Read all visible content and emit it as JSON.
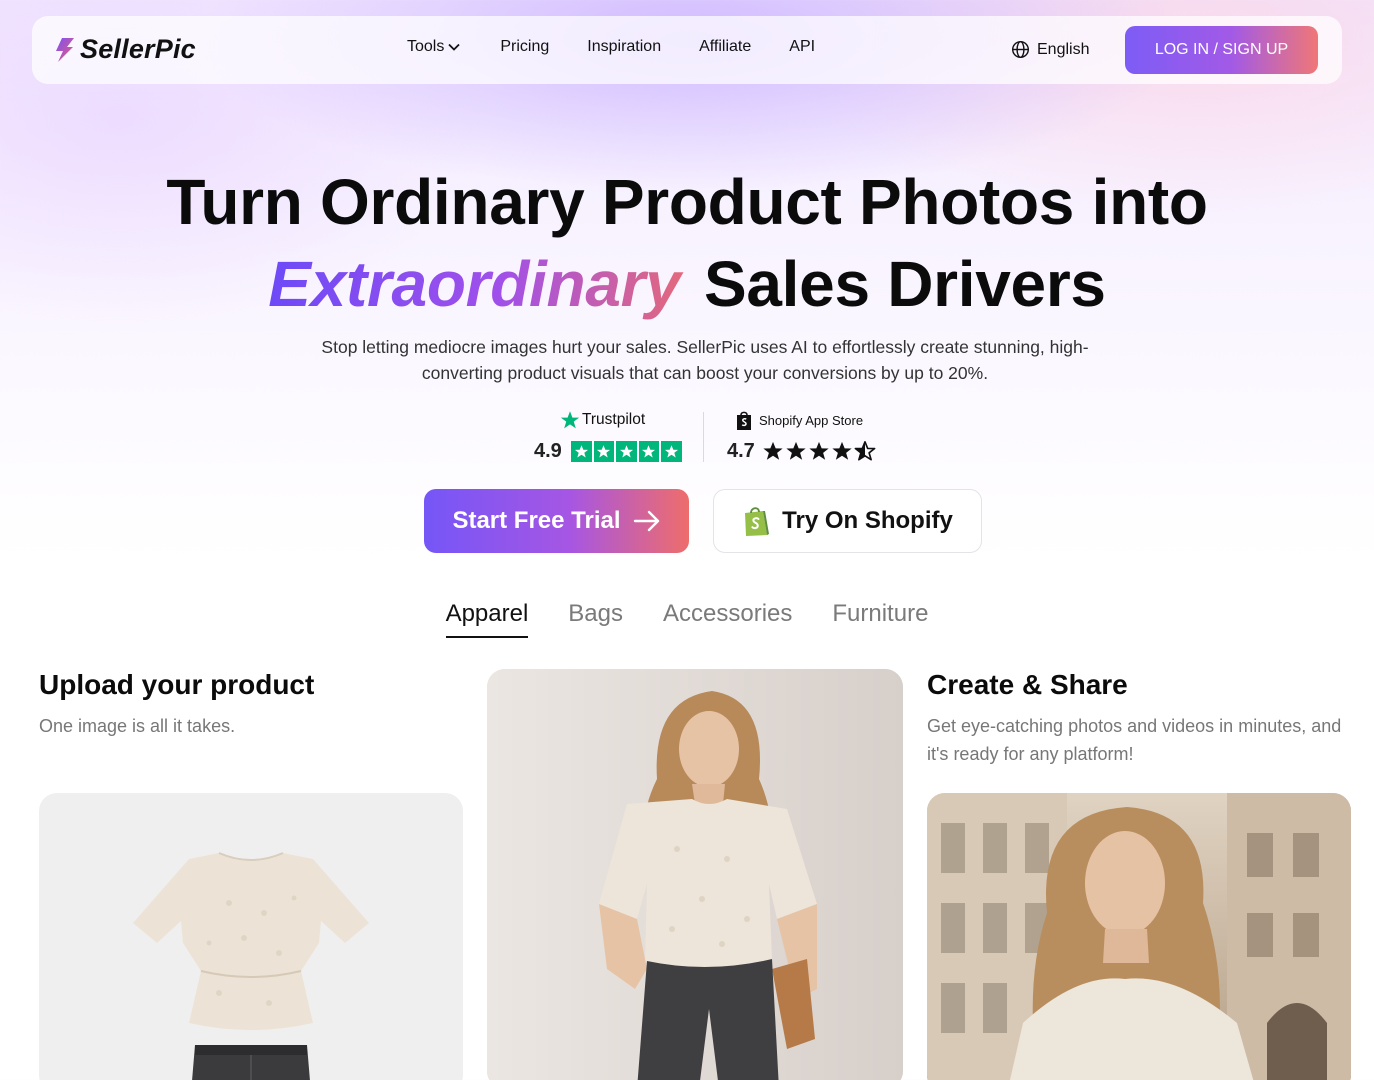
{
  "nav": {
    "logo_text": "SellerPic",
    "links": {
      "tools": "Tools",
      "pricing": "Pricing",
      "inspiration": "Inspiration",
      "affiliate": "Affiliate",
      "api": "API"
    },
    "language": "English",
    "login_label": "LOG IN / SIGN UP"
  },
  "hero": {
    "line1": "Turn Ordinary Product Photos into",
    "line2_highlight": "Extraordinary",
    "line2_rest": "Sales Drivers",
    "subtitle": "Stop letting mediocre images hurt your sales. SellerPic uses AI to effortlessly create stunning, high-converting product visuals that can boost your conversions by up to 20%."
  },
  "ratings": {
    "trustpilot": {
      "brand": "Trustpilot",
      "score": "4.9",
      "stars": 5
    },
    "shopify": {
      "brand": "Shopify App Store",
      "score": "4.7",
      "stars": 4.5
    }
  },
  "cta": {
    "primary": "Start Free Trial",
    "secondary": "Try On Shopify"
  },
  "tabs": [
    {
      "label": "Apparel",
      "active": true
    },
    {
      "label": "Bags",
      "active": false
    },
    {
      "label": "Accessories",
      "active": false
    },
    {
      "label": "Furniture",
      "active": false
    }
  ],
  "steps": {
    "upload": {
      "title": "Upload your product",
      "desc": "One image is all it takes."
    },
    "share": {
      "title": "Create & Share",
      "desc": "Get eye-catching photos and videos in minutes, and it's ready for any platform!"
    }
  },
  "colors": {
    "brand_gradient_start": "#7556f7",
    "brand_gradient_mid": "#a656e3",
    "brand_gradient_end": "#ee6d6b",
    "trustpilot_green": "#00b67a",
    "shopify_green": "#95bf47"
  },
  "icons": {
    "logo": "sellerpic-logo-icon",
    "tools_dropdown": "chevron-down-icon",
    "language": "globe-icon",
    "trustpilot": "trustpilot-star-icon",
    "shopify": "shopify-bag-icon",
    "cta_arrow": "arrow-right-icon"
  }
}
